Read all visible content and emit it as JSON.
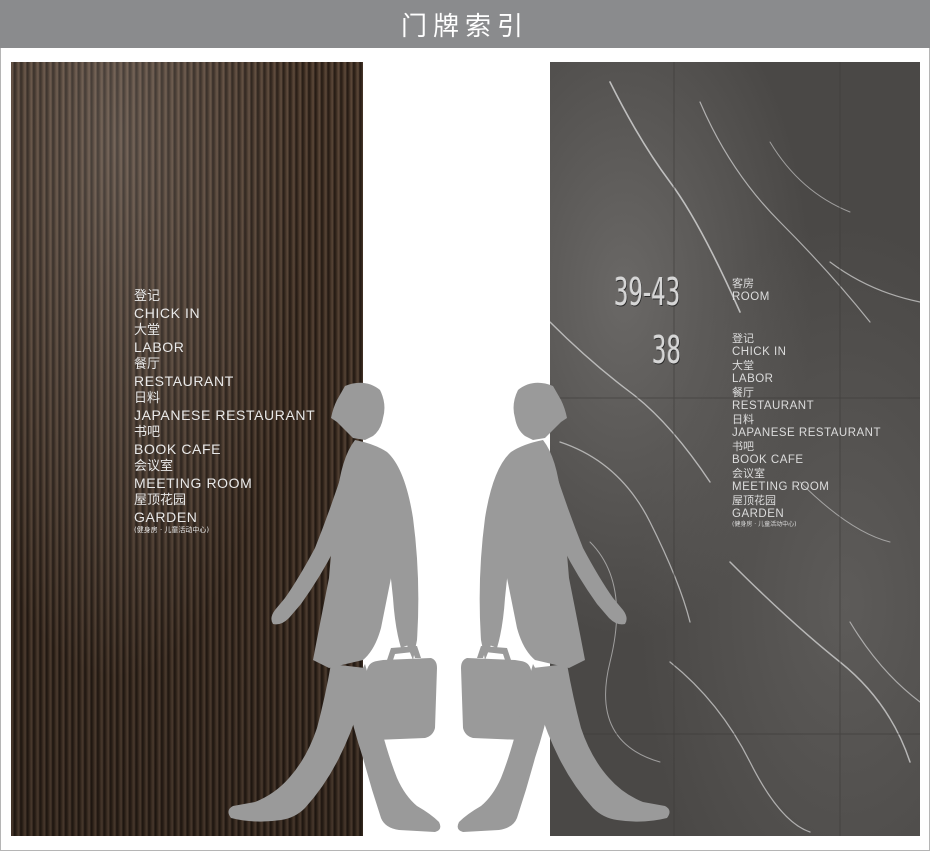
{
  "header": {
    "title": "门牌索引"
  },
  "left_sign": {
    "entries": [
      {
        "cn": "登记",
        "en": "CHICK IN"
      },
      {
        "cn": "大堂",
        "en": "LABOR"
      },
      {
        "cn": "餐厅",
        "en": "RESTAURANT"
      },
      {
        "cn": "日料",
        "en": "JAPANESE RESTAURANT"
      },
      {
        "cn": "书吧",
        "en": "BOOK CAFE"
      },
      {
        "cn": "会议室",
        "en": "MEETING ROOM"
      },
      {
        "cn": "屋顶花园",
        "en": "GARDEN"
      }
    ],
    "note": "(健身房 · 儿童活动中心)"
  },
  "right_sign": {
    "room_range": "39-43",
    "room_single": "38",
    "room_cn": "客房",
    "room_en": "ROOM",
    "entries": [
      {
        "cn": "登记",
        "en": "CHICK IN"
      },
      {
        "cn": "大堂",
        "en": "LABOR"
      },
      {
        "cn": "餐厅",
        "en": "RESTAURANT"
      },
      {
        "cn": "日料",
        "en": "JAPANESE RESTAURANT"
      },
      {
        "cn": "书吧",
        "en": "BOOK CAFE"
      },
      {
        "cn": "会议室",
        "en": "MEETING ROOM"
      },
      {
        "cn": "屋顶花园",
        "en": "GARDEN"
      }
    ],
    "note": "(健身房 · 儿童活动中心)"
  },
  "colors": {
    "header_bg": "#8a8b8d",
    "wood": "#3a2a1f",
    "marble": "#4a4846",
    "silhouette": "#9a9a9a"
  }
}
